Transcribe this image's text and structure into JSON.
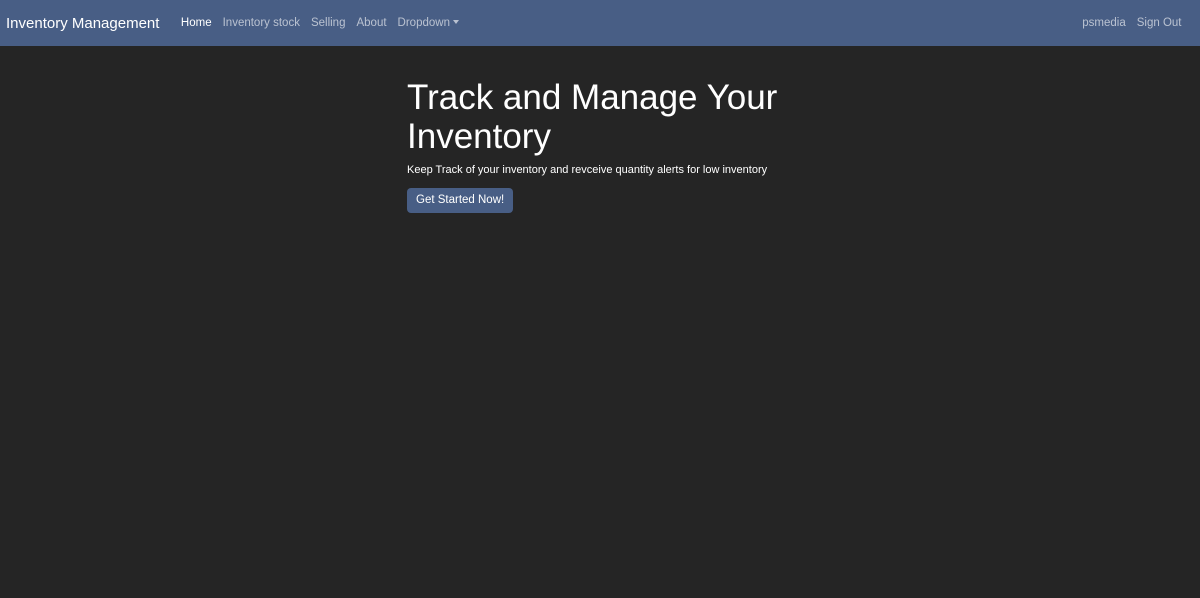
{
  "navbar": {
    "brand": "Inventory Management",
    "links": [
      {
        "label": "Home",
        "active": true
      },
      {
        "label": "Inventory stock"
      },
      {
        "label": "Selling"
      },
      {
        "label": "About"
      },
      {
        "label": "Dropdown"
      }
    ],
    "user": "psmedia",
    "sign_out": "Sign Out"
  },
  "hero": {
    "title": "Track and Manage Your Inventory",
    "lead": "Keep Track of your inventory and revceive quantity alerts for low inventory",
    "cta": "Get Started Now!"
  },
  "colors": {
    "navbar_bg": "#485e85",
    "page_bg": "#252525",
    "button_bg": "#485e85"
  }
}
